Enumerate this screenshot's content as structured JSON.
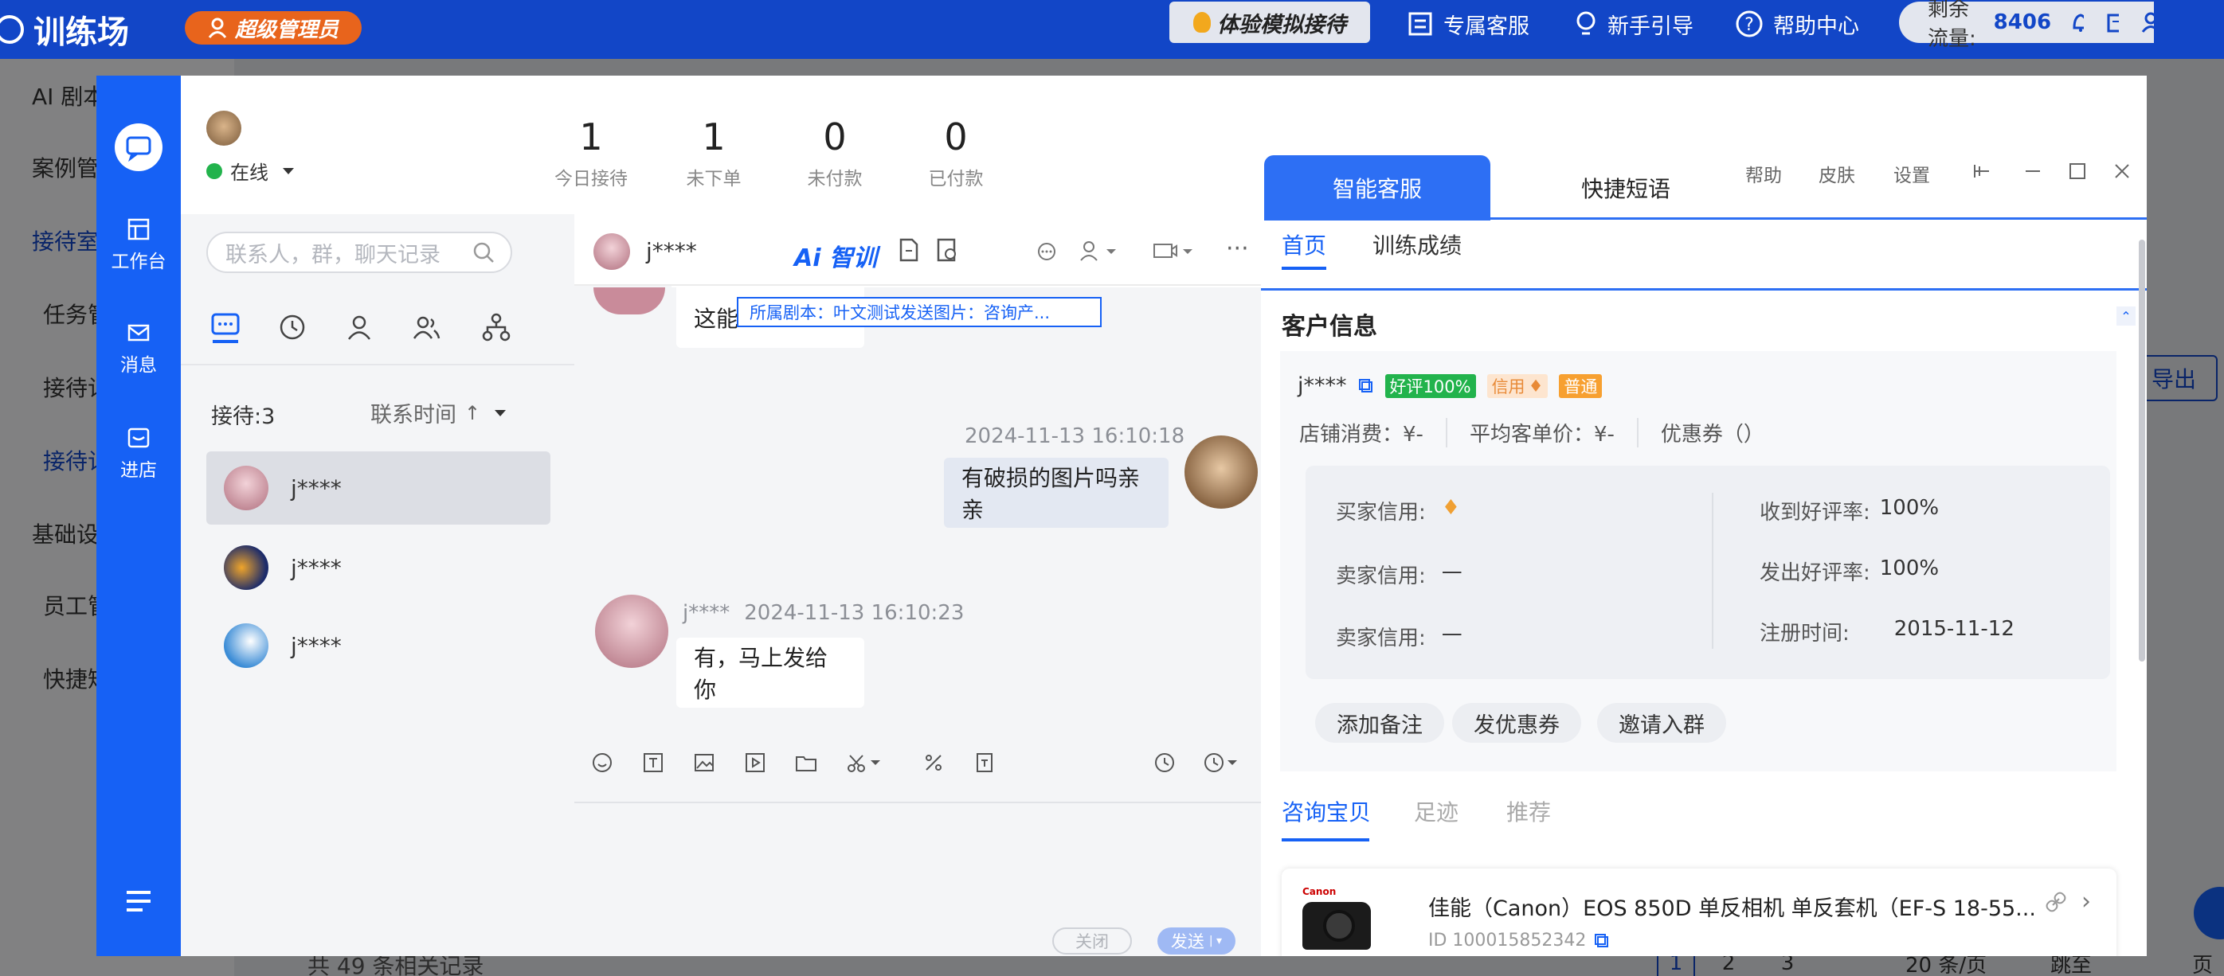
{
  "topbar": {
    "app_name": "训练场",
    "admin_label": "超级管理员",
    "experience_label": "体验模拟接待",
    "links": [
      "专属客服",
      "新手引导",
      "帮助中心"
    ],
    "flow_label": "剩余流量:",
    "flow_value": "8406"
  },
  "bg": {
    "side_items": [
      "AI 剧本",
      "案例管",
      "接待室",
      "任务管",
      "接待记",
      "接待记",
      "基础设",
      "员工管",
      "快捷短"
    ],
    "export_label": "导出",
    "footer_count": "共 49 条相关记录",
    "pagination": [
      "1",
      "2",
      "3"
    ],
    "page_size": "20 条/页",
    "jump_label": "跳至",
    "page_suffix": "页"
  },
  "window": {
    "controls": [
      "帮助",
      "皮肤",
      "设置"
    ]
  },
  "rail": {
    "items": [
      "工作台",
      "消息",
      "进店"
    ]
  },
  "user": {
    "status": "在线"
  },
  "stats": [
    {
      "value": "1",
      "label": "今日接待"
    },
    {
      "value": "1",
      "label": "未下单"
    },
    {
      "value": "0",
      "label": "未付款"
    },
    {
      "value": "0",
      "label": "已付款"
    }
  ],
  "contacts": {
    "search_placeholder": "联系人，群，聊天记录",
    "count_label": "接待:3",
    "sort_label": "联系时间",
    "list": [
      {
        "name": "j****"
      },
      {
        "name": "j****"
      },
      {
        "name": "j****"
      }
    ]
  },
  "chat": {
    "contact_name": "j****",
    "ai_label": "Ai 智训",
    "script_banner": "所属剧本：叶文测试发送图片：咨询产...",
    "messages": [
      {
        "side": "left",
        "text": "这能"
      },
      {
        "side": "right",
        "time": "2024-11-13 16:10:18",
        "text": "有破损的图片吗亲亲"
      },
      {
        "side": "left",
        "name": "j****",
        "time": "2024-11-13 16:10:23",
        "text": "有，马上发给你"
      }
    ],
    "close_label": "关闭",
    "send_label": "发送"
  },
  "right": {
    "tabs": [
      "智能客服",
      "快捷短语"
    ],
    "subtabs": [
      "首页",
      "训练成绩"
    ],
    "customer_title": "客户信息",
    "customer_name": "j****",
    "tags": [
      "好评100%",
      "信用",
      "普通"
    ],
    "summary": [
      "店铺消费：¥-",
      "平均客单价：¥-",
      "优惠券（）"
    ],
    "credit_rows": [
      {
        "label": "买家信用:",
        "value": ""
      },
      {
        "label": "卖家信用:",
        "value": "—"
      },
      {
        "label": "卖家信用:",
        "value": "—"
      }
    ],
    "rate_rows": [
      {
        "label": "收到好评率:",
        "value": "100%"
      },
      {
        "label": "发出好评率:",
        "value": "100%"
      },
      {
        "label": "注册时间:",
        "value": "2015-11-12"
      }
    ],
    "actions": [
      "添加备注",
      "发优惠券",
      "邀请入群"
    ],
    "consult_tabs": [
      "咨询宝贝",
      "足迹",
      "推荐"
    ],
    "product": {
      "brand": "Canon",
      "title": "佳能（Canon）EOS 850D 单反相机 单反套机（EF-S 18-55...",
      "id": "ID 100015852342"
    }
  },
  "colors": {
    "primary": "#1661f5",
    "topbar": "#1246c7",
    "accent": "#e8641c",
    "green": "#22b34c"
  }
}
